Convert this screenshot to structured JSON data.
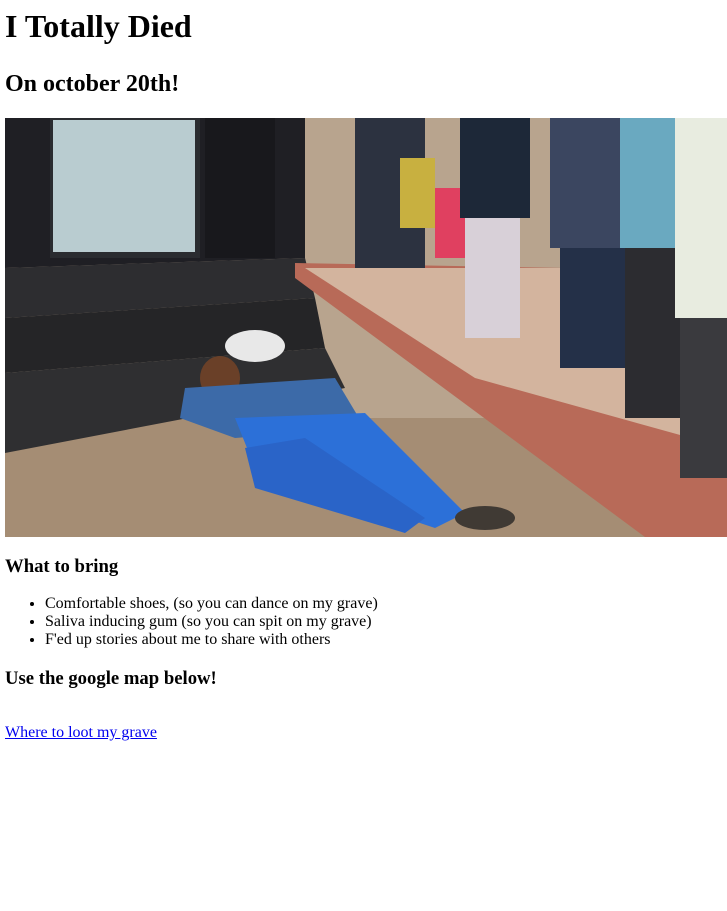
{
  "page": {
    "title": "I Totally Died",
    "subtitle": "On october 20th!",
    "bring_heading": "What to bring",
    "bring_items": [
      "Comfortable shoes, (so you can dance on my grave)",
      "Saliva inducing gum (so you can spit on my grave)",
      "F'ed up stories about me to share with others"
    ],
    "map_heading": "Use the google map below!",
    "map_link": "Where to loot my grave"
  },
  "colors": {
    "link": "#0000ee",
    "text": "#000000",
    "background": "#ffffff"
  }
}
